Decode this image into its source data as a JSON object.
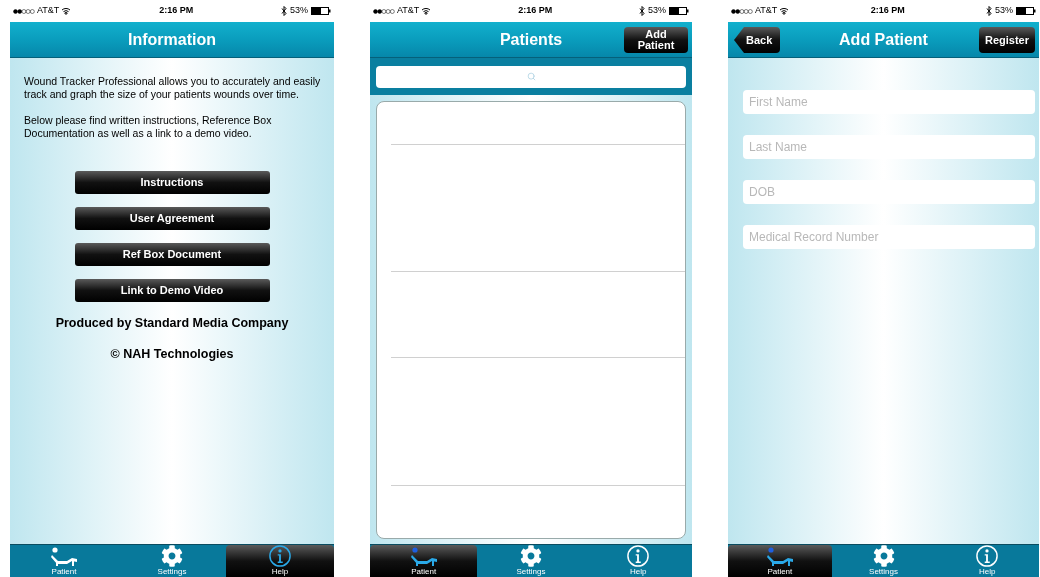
{
  "screens": [
    {
      "kind": "info",
      "status": {
        "carrier": "AT&T",
        "time": "2:16 PM",
        "battery": "53%"
      },
      "title": "Information",
      "paragraphs": [
        "Wound Tracker Professional allows you to accurately and easily track and graph the size of your patients wounds over time.",
        "Below please find written instructions, Reference Box Documentation as well as a link to a demo video."
      ],
      "buttons": [
        "Instructions",
        "User Agreement",
        "Ref Box Document",
        "Link to Demo Video"
      ],
      "credits": [
        "Produced by Standard Media Company",
        "© NAH Technologies"
      ],
      "tabs": [
        {
          "label": "Patient",
          "kind": "patient",
          "selected": false
        },
        {
          "label": "Settings",
          "kind": "settings",
          "selected": false
        },
        {
          "label": "Help",
          "kind": "help",
          "selected": true
        }
      ]
    },
    {
      "kind": "list",
      "status": {
        "carrier": "AT&T",
        "time": "2:16 PM",
        "battery": "53%"
      },
      "title": "Patients",
      "right_button": "Add Patient",
      "tabs": [
        {
          "label": "Patient",
          "kind": "patient",
          "selected": true
        },
        {
          "label": "Settings",
          "kind": "settings",
          "selected": false
        },
        {
          "label": "Help",
          "kind": "help",
          "selected": false
        }
      ]
    },
    {
      "kind": "form",
      "status": {
        "carrier": "AT&T",
        "time": "2:16 PM",
        "battery": "53%"
      },
      "title": "Add Patient",
      "left_button": "Back",
      "right_button": "Register",
      "fields": [
        {
          "placeholder": "First Name"
        },
        {
          "placeholder": "Last Name"
        },
        {
          "placeholder": "DOB"
        },
        {
          "placeholder": "Medical Record Number"
        }
      ],
      "tabs": [
        {
          "label": "Patient",
          "kind": "patient",
          "selected": true
        },
        {
          "label": "Settings",
          "kind": "settings",
          "selected": false
        },
        {
          "label": "Help",
          "kind": "help",
          "selected": false
        }
      ]
    }
  ]
}
